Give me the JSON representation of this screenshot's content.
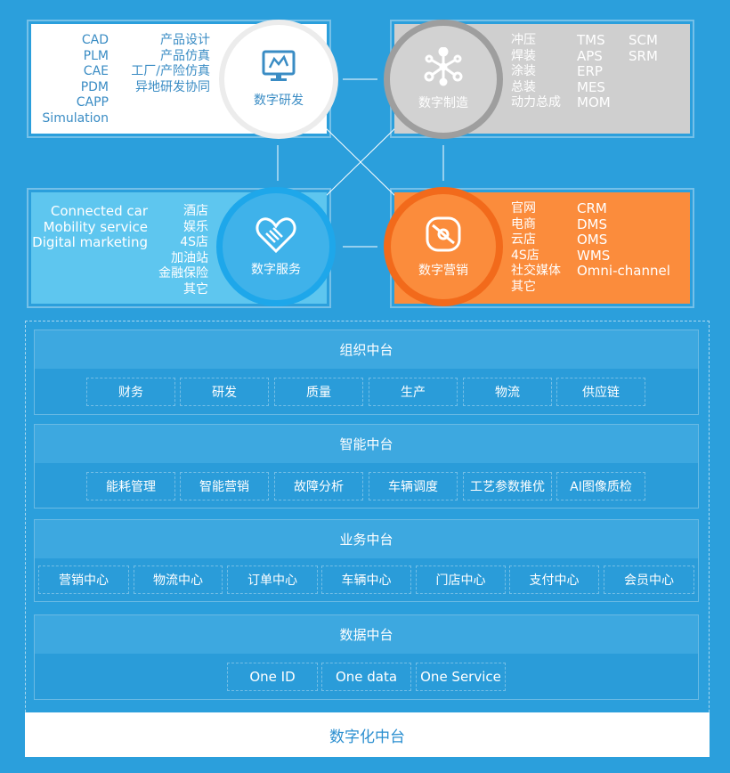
{
  "rd": {
    "title": "数字研发",
    "left": [
      "CAD",
      "PLM",
      "CAE",
      "PDM",
      "CAPP",
      "Simulation"
    ],
    "right": [
      "产品设计",
      "产品仿真",
      "工厂/产险仿真",
      "异地研发协同"
    ]
  },
  "mfg": {
    "title": "数字制造",
    "c1": [
      "冲压",
      "焊装",
      "涂装",
      "总装",
      "动力总成"
    ],
    "c2": [
      "TMS",
      "APS",
      "ERP",
      "MES",
      "MOM"
    ],
    "c3": [
      "SCM",
      "SRM"
    ]
  },
  "svc": {
    "title": "数字服务",
    "left": [
      "Connected car",
      "Mobility service",
      "Digital marketing"
    ],
    "right": [
      "酒店",
      "娱乐",
      "4S店",
      "加油站",
      "金融保险",
      "其它"
    ]
  },
  "mkt": {
    "title": "数字营销",
    "c1": [
      "官网",
      "电商",
      "云店",
      "4S店",
      "社交媒体",
      "其它"
    ],
    "c2": [
      "CRM",
      "DMS",
      "OMS",
      "WMS",
      "Omni-channel"
    ]
  },
  "sections": [
    {
      "title": "组织中台",
      "items": [
        "财务",
        "研发",
        "质量",
        "生产",
        "物流",
        "供应链"
      ]
    },
    {
      "title": "智能中台",
      "items": [
        "能耗管理",
        "智能营销",
        "故障分析",
        "车辆调度",
        "工艺参数推优",
        "AI图像质检"
      ]
    },
    {
      "title": "业务中台",
      "items": [
        "营销中心",
        "物流中心",
        "订单中心",
        "车辆中心",
        "门店中心",
        "支付中心",
        "会员中心"
      ]
    },
    {
      "title": "数据中台",
      "items": [
        "One ID",
        "One data",
        "One Service"
      ]
    }
  ],
  "footer": "数字化中台",
  "colors": {
    "bg": "#2b9fdc",
    "rd": "#ffffff",
    "mfg": "#cfcfcf",
    "svc": "#5ec6ef",
    "mkt": "#fb8c3c"
  }
}
